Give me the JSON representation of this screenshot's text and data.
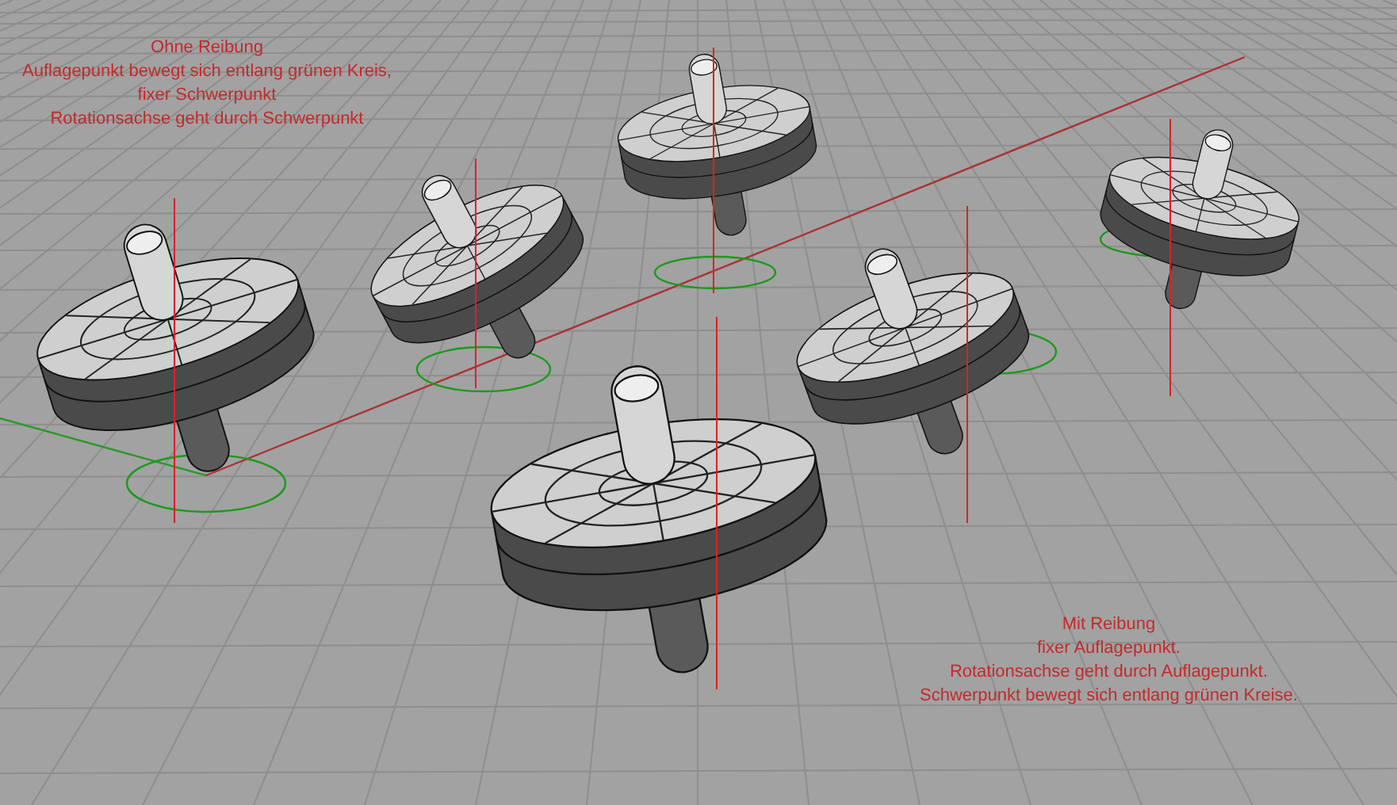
{
  "annotations": [
    {
      "lines": [
        "Ohne Reibung",
        "Auflagepunkt bewegt sich entlang grünen Kreis,",
        "fixer Schwerpunkt",
        "Rotationsachse geht durch Schwerpunkt"
      ]
    },
    {
      "lines": [
        "Mit Reibung",
        "fixer Auflagepunkt.",
        "Rotationsachse geht durch Auflagepunkt.",
        "Schwerpunkt bewegt sich entlang grünen Kreise."
      ]
    }
  ]
}
